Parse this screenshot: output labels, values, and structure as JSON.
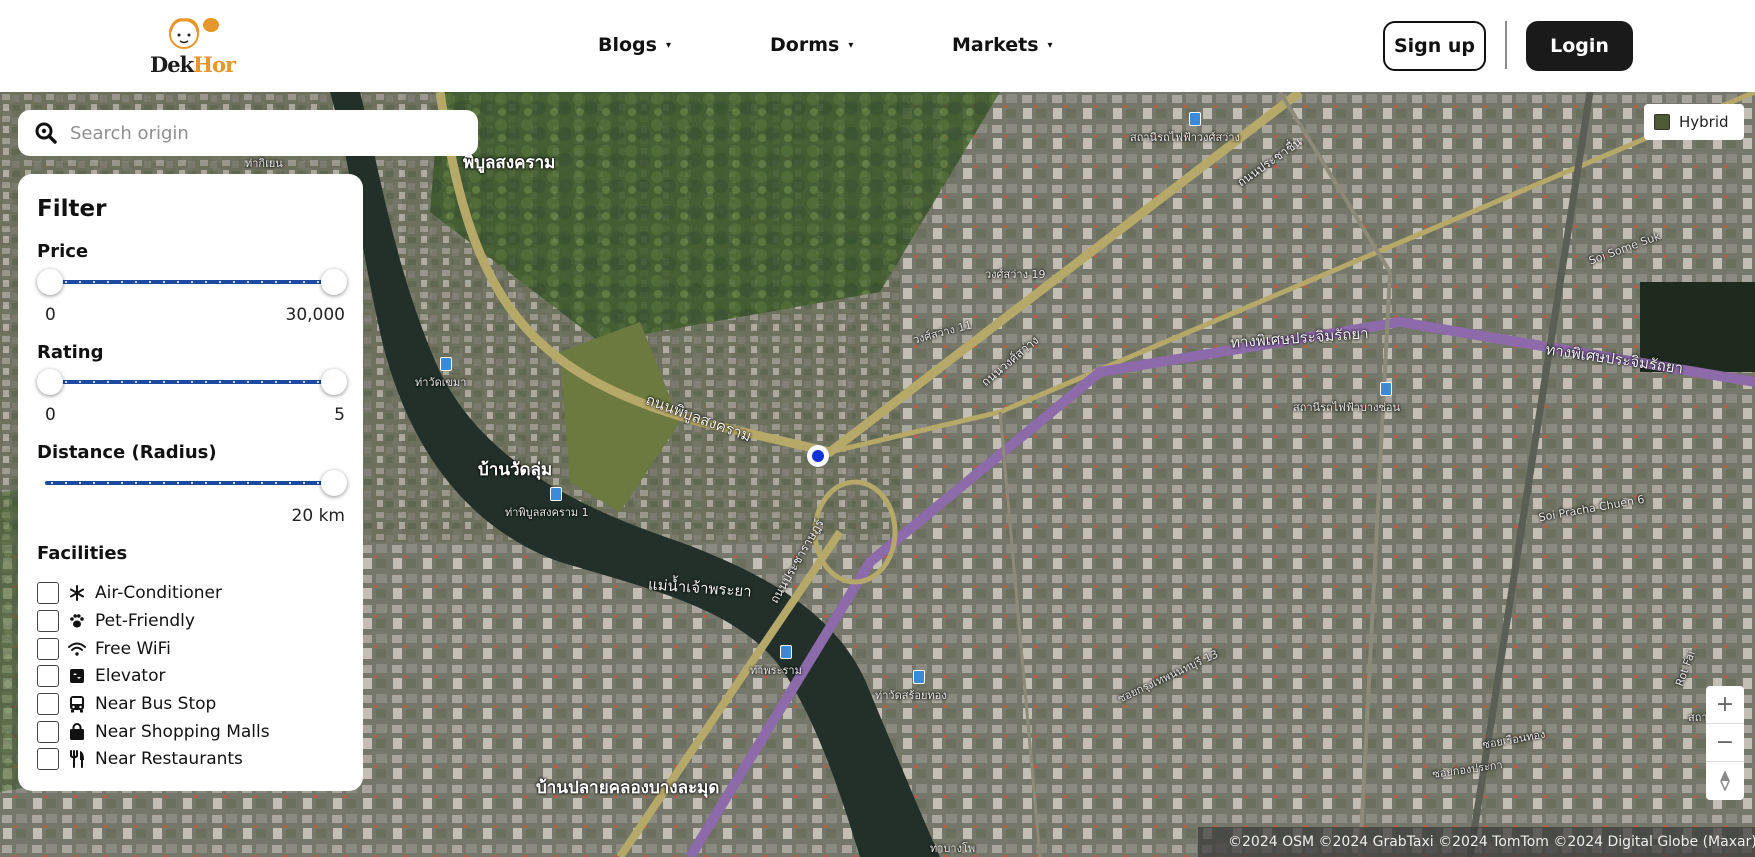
{
  "header": {
    "logo": {
      "part1": "Dek",
      "part2": "Hor"
    },
    "nav": [
      {
        "label": "Blogs"
      },
      {
        "label": "Dorms"
      },
      {
        "label": "Markets"
      }
    ],
    "signup_label": "Sign up",
    "login_label": "Login",
    "caret": "▾"
  },
  "search": {
    "placeholder": "Search origin"
  },
  "filter": {
    "title": "Filter",
    "price": {
      "label": "Price",
      "min": "0",
      "max": "30,000",
      "low": 0,
      "high": 30000
    },
    "rating": {
      "label": "Rating",
      "min": "0",
      "max": "5",
      "low": 0,
      "high": 5
    },
    "distance": {
      "label": "Distance (Radius)",
      "value": "20 km",
      "current": 20
    },
    "facilities_label": "Facilities",
    "facilities": [
      {
        "label": "Air-Conditioner",
        "icon": "snowflake-icon",
        "checked": false
      },
      {
        "label": "Pet-Friendly",
        "icon": "paw-icon",
        "checked": false
      },
      {
        "label": "Free WiFi",
        "icon": "wifi-icon",
        "checked": false
      },
      {
        "label": "Elevator",
        "icon": "elevator-icon",
        "checked": false
      },
      {
        "label": "Near Bus Stop",
        "icon": "bus-icon",
        "checked": false
      },
      {
        "label": "Near Shopping Malls",
        "icon": "shopping-bag-icon",
        "checked": false
      },
      {
        "label": "Near Restaurants",
        "icon": "utensils-icon",
        "checked": false
      }
    ]
  },
  "map": {
    "layer_label": "Hybrid",
    "zoom_in": "+",
    "zoom_out": "−",
    "attribution": "©2024 OSM ©2024 GrabTaxi ©2024 TomTom ©2024 Digital Globe (Maxar)",
    "labels": {
      "phibun": "พิบูลสงคราม",
      "banwatlum": "บ้านวัดลุ่ม",
      "banplai": "บ้านปลายคลองบางละมุด",
      "river": "แม่น้ำเจ้าพระยา",
      "thnon_phibun": "ถนนพิบูลสงคราม",
      "thnon_pracharat": "ถนนประชาราษฎร์",
      "thnon_krungthep": "ถนนกรุงเทพ",
      "expressway1": "ทางพิเศษประจิมรัถยา",
      "expressway2": "ทางพิเศษประจิมรัถยา",
      "pier1": "ท่าวัดเขมา",
      "pier2": "ท่าพิบูลสงคราม 1",
      "pier3": "ท่าพระราม",
      "pier4": "ท่าวัดสร้อยทอง",
      "pier5": "ท่ากิเยน",
      "station1": "สถานีรถไฟฟ้าวงศ์สว่าง",
      "station2": "สถานีรถไฟฟ้าบางซ่อน",
      "road_wongsawang": "ถนนวงศ์สว่าง",
      "soi_wongsawang19": "วงศ์สว่าง 19",
      "soi_wongsawang11": "วงศ์สว่าง 11",
      "soi_some_suk": "Soi Some Suk",
      "soi_pracha": "Soi Pracha Chuen 6",
      "soi_kanchana": "ซอยกาญจนาภิเษก",
      "soi_krungthep": "ซอยกรุงเทพนนทบุรี 13",
      "soi_hutakam": "ซอยเรือนทอง",
      "soi_bangson": "ซอยกองประกา",
      "rot_fai": "Rot Fai",
      "sathani": "สถานีรถไฟ",
      "tha_bang_pho": "ท่าบางโพ",
      "soi_pracharat": "ถนนประชาราษฎร์",
      "prachachuen": "ถนนประชาชื่น"
    }
  }
}
